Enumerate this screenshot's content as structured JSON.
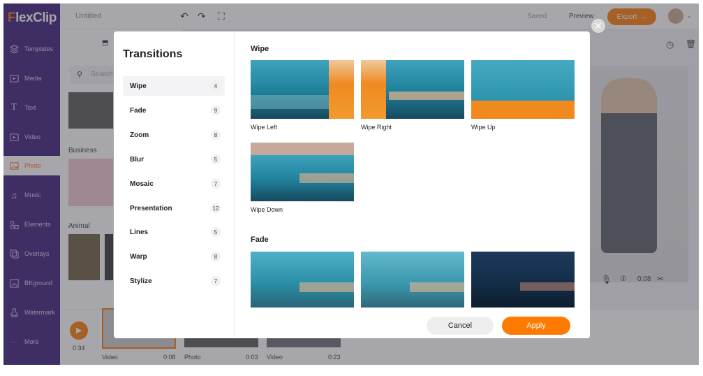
{
  "app": {
    "brand_initial": "F",
    "brand_rest": "lexClip",
    "project_title": "Untitled",
    "saved_label": "Saved",
    "preview_label": "Preview",
    "export_label": "Export",
    "accent_color": "#ff7a00"
  },
  "sidebar": {
    "items": [
      {
        "label": "Templates",
        "icon": "layers-icon"
      },
      {
        "label": "Media",
        "icon": "media-icon"
      },
      {
        "label": "Text",
        "icon": "text-icon"
      },
      {
        "label": "Video",
        "icon": "video-icon"
      },
      {
        "label": "Photo",
        "icon": "photo-icon",
        "active": true
      },
      {
        "label": "Music",
        "icon": "music-icon"
      },
      {
        "label": "Elements",
        "icon": "elements-icon"
      },
      {
        "label": "Overlays",
        "icon": "overlays-icon"
      },
      {
        "label": "BKground",
        "icon": "background-icon"
      },
      {
        "label": "Watermark",
        "icon": "watermark-icon"
      },
      {
        "label": "More",
        "icon": "more-icon"
      }
    ]
  },
  "library": {
    "search_placeholder": "Search",
    "section_business": "Business",
    "section_animal": "Animal"
  },
  "player": {
    "time": "0:08"
  },
  "timeline": {
    "current_time": "0:34",
    "clips": [
      {
        "type": "Video",
        "duration": "0:08"
      },
      {
        "type": "Photo",
        "duration": "0:03"
      },
      {
        "type": "Video",
        "duration": "0:23"
      }
    ]
  },
  "modal": {
    "title": "Transitions",
    "categories": [
      {
        "label": "Wipe",
        "count": "4"
      },
      {
        "label": "Fade",
        "count": "9"
      },
      {
        "label": "Zoom",
        "count": "8"
      },
      {
        "label": "Blur",
        "count": "5"
      },
      {
        "label": "Mosaic",
        "count": "7"
      },
      {
        "label": "Presentation",
        "count": "12"
      },
      {
        "label": "Lines",
        "count": "5"
      },
      {
        "label": "Warp",
        "count": "8"
      },
      {
        "label": "Stylize",
        "count": "7"
      }
    ],
    "sections": [
      {
        "title": "Wipe",
        "items": [
          "Wipe Left",
          "Wipe Right",
          "Wipe Up",
          "Wipe Down"
        ]
      },
      {
        "title": "Fade",
        "items": [
          "",
          "",
          ""
        ]
      }
    ],
    "cancel_label": "Cancel",
    "apply_label": "Apply"
  }
}
